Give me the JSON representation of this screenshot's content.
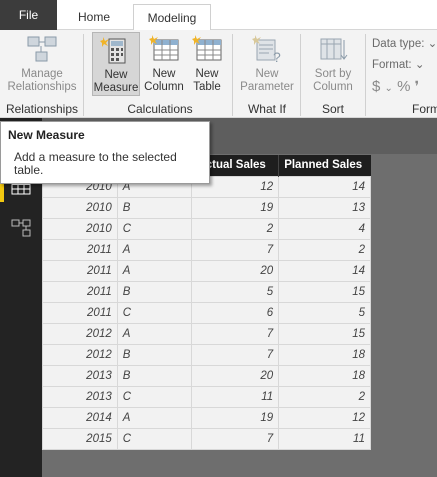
{
  "tabs": {
    "file": "File",
    "home": "Home",
    "modeling": "Modeling"
  },
  "ribbon": {
    "manage_relationships": "Manage\nRelationships",
    "group_relationships": "Relationships",
    "new_measure": "New\nMeasure",
    "new_column": "New\nColumn",
    "new_table": "New\nTable",
    "group_calculations": "Calculations",
    "new_parameter": "New\nParameter",
    "group_whatif": "What If",
    "sort_by_column": "Sort by\nColumn",
    "group_sort": "Sort",
    "data_type": "Data type:",
    "format": "Format:",
    "currency_symbol": "$",
    "percent_symbol": "%",
    "group_formatting": "Form"
  },
  "tooltip": {
    "title": "New Measure",
    "body": "Add a measure to the selected table."
  },
  "table": {
    "headers": [
      "",
      "",
      "Actual Sales",
      "Planned Sales"
    ],
    "rows": [
      [
        "2010",
        "A",
        "12",
        "14"
      ],
      [
        "2010",
        "B",
        "19",
        "13"
      ],
      [
        "2010",
        "C",
        "2",
        "4"
      ],
      [
        "2011",
        "A",
        "7",
        "2"
      ],
      [
        "2011",
        "A",
        "20",
        "14"
      ],
      [
        "2011",
        "B",
        "5",
        "15"
      ],
      [
        "2011",
        "C",
        "6",
        "5"
      ],
      [
        "2012",
        "A",
        "7",
        "15"
      ],
      [
        "2012",
        "B",
        "7",
        "18"
      ],
      [
        "2013",
        "B",
        "20",
        "18"
      ],
      [
        "2013",
        "C",
        "11",
        "2"
      ],
      [
        "2014",
        "A",
        "19",
        "12"
      ],
      [
        "2015",
        "C",
        "7",
        "11"
      ]
    ]
  },
  "colors": {
    "file_tab_bg": "#3c3c3c",
    "rail_bg": "#232323",
    "rail_active": "#f2c811",
    "canvas_bg": "#6e6e6e",
    "header_bg": "#1e1e1e"
  }
}
